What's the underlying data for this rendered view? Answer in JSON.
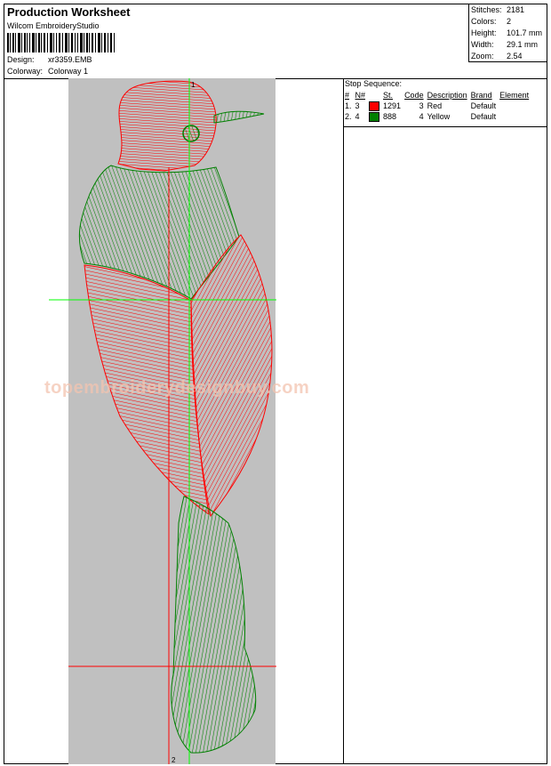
{
  "header": {
    "title": "Production Worksheet",
    "company": "Wilcom EmbroideryStudio",
    "design_label": "Design:",
    "design_value": "xr3359.EMB",
    "colorway_label": "Colorway:",
    "colorway_value": "Colorway 1"
  },
  "stats": [
    {
      "label": "Stitches:",
      "value": "2181"
    },
    {
      "label": "Colors:",
      "value": "2"
    },
    {
      "label": "Height:",
      "value": "101.7 mm"
    },
    {
      "label": "Width:",
      "value": "29.1 mm"
    },
    {
      "label": "Zoom:",
      "value": "2.54"
    }
  ],
  "stop_sequence": {
    "caption": "Stop Sequence:",
    "columns": [
      "#",
      "N#",
      "",
      "St.",
      "Code",
      "Description",
      "Brand",
      "Element"
    ],
    "rows": [
      {
        "idx": "1.",
        "n": "3",
        "color": "#ff0000",
        "st": "1291",
        "code": "3",
        "description": "Red",
        "brand": "Default",
        "element": ""
      },
      {
        "idx": "2.",
        "n": "4",
        "color": "#008000",
        "st": "888",
        "code": "4",
        "description": "Yellow",
        "brand": "Default",
        "element": ""
      }
    ]
  },
  "canvas": {
    "watermark": "topembroiderydesignbuy.com",
    "markers": [
      "1",
      "2"
    ],
    "colors": {
      "red": "#ff0000",
      "green": "#008000",
      "guide": "#00ff00",
      "background": "#c0c0c0"
    }
  }
}
